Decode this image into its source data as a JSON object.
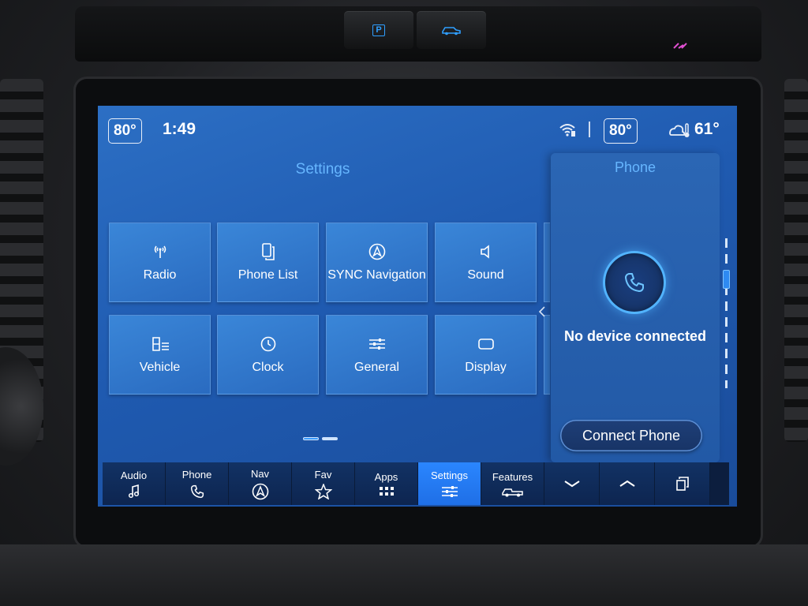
{
  "status_bar": {
    "driver_temp": "80°",
    "time": "1:49",
    "passenger_temp": "80°",
    "outside_temp": "61°",
    "icons": [
      "wifi-icon",
      "outside-temp-icon"
    ]
  },
  "hardware_buttons": {
    "parking_label": "P",
    "icons": [
      "parking-sensor-icon",
      "vehicle-icon"
    ]
  },
  "settings": {
    "title": "Settings",
    "tiles": [
      {
        "label": "Radio",
        "icon": "radio-antenna-icon"
      },
      {
        "label": "Phone List",
        "icon": "phone-list-icon"
      },
      {
        "label": "SYNC Navigation",
        "icon": "navigation-icon"
      },
      {
        "label": "Sound",
        "icon": "speaker-icon"
      },
      {
        "label": "Vehicle",
        "icon": "vehicle-settings-icon"
      },
      {
        "label": "Clock",
        "icon": "clock-icon"
      },
      {
        "label": "General",
        "icon": "sliders-icon"
      },
      {
        "label": "Display",
        "icon": "display-icon"
      }
    ],
    "page_indicator": {
      "current": 1,
      "total": 2
    }
  },
  "phone_panel": {
    "title": "Phone",
    "status": "No device connected",
    "connect_button": "Connect Phone",
    "icon": "phone-icon"
  },
  "nav_bar": {
    "items": [
      {
        "label": "Audio",
        "icon": "music-note-icon"
      },
      {
        "label": "Phone",
        "icon": "phone-icon"
      },
      {
        "label": "Nav",
        "icon": "navigation-icon"
      },
      {
        "label": "Fav",
        "icon": "star-icon"
      },
      {
        "label": "Apps",
        "icon": "apps-grid-icon"
      },
      {
        "label": "Settings",
        "icon": "sliders-icon",
        "active": true
      },
      {
        "label": "Features",
        "icon": "truck-icon"
      }
    ],
    "controls": [
      "chevron-down-icon",
      "chevron-up-icon",
      "multitask-icon"
    ]
  },
  "colors": {
    "screen_bg": "#1f5ab0",
    "accent": "#66b6ff",
    "active_tab": "#2a86ff",
    "nav_bg": "#0d2550"
  }
}
